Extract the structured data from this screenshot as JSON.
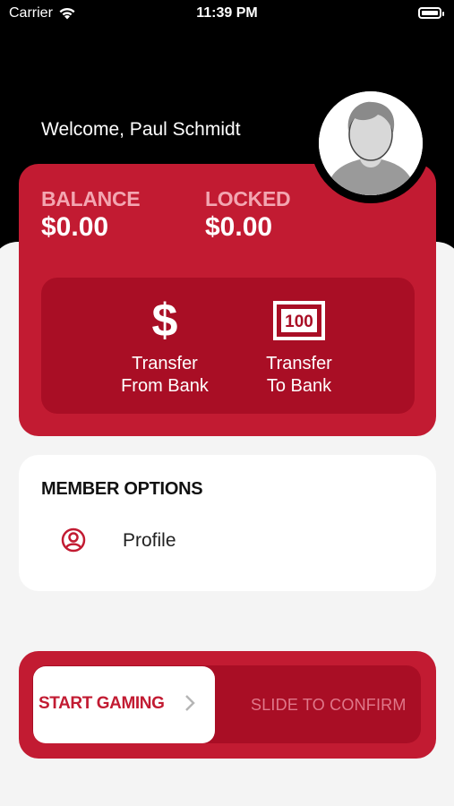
{
  "status_bar": {
    "carrier": "Carrier",
    "time": "11:39 PM"
  },
  "header": {
    "welcome": "Welcome, Paul Schmidt"
  },
  "balance_card": {
    "balance_label": "BALANCE",
    "balance_value": "$0.00",
    "locked_label": "LOCKED",
    "locked_value": "$0.00",
    "actions": [
      {
        "label_line1": "Transfer",
        "label_line2": "From Bank",
        "icon": "dollar-icon"
      },
      {
        "label_line1": "Transfer",
        "label_line2": "To Bank",
        "icon": "banknote-icon",
        "icon_text": "100"
      }
    ]
  },
  "member_options": {
    "title": "MEMBER OPTIONS",
    "items": [
      {
        "label": "Profile",
        "icon": "profile-icon"
      }
    ]
  },
  "slider": {
    "knob_label": "START GAMING",
    "hint": "SLIDE TO CONFIRM"
  },
  "colors": {
    "brand_red": "#c21b32",
    "dark_red": "#a90e25",
    "label_pink": "#f3a6b1",
    "background": "#f4f4f4"
  }
}
